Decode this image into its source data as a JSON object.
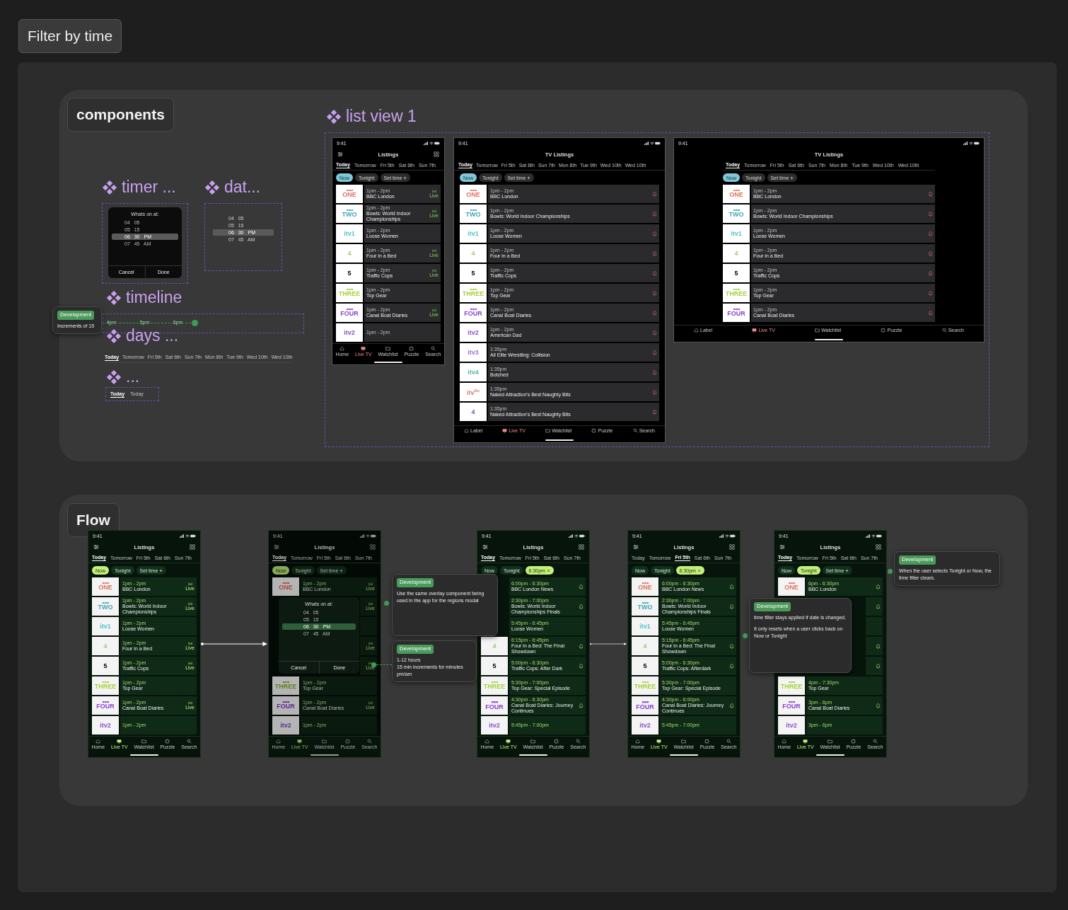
{
  "title": "Filter by time",
  "components": {
    "heading": "components",
    "timer": {
      "label": "timer ...",
      "modal": {
        "title": "Whats on at:",
        "wheel": [
          {
            "values": [
              "04",
              "05"
            ],
            "selected": false
          },
          {
            "values": [
              "05",
              "15"
            ],
            "selected": false
          },
          {
            "values": [
              "06",
              "30",
              "PM"
            ],
            "selected": true
          },
          {
            "values": [
              "07",
              "45",
              "AM"
            ],
            "selected": false
          }
        ],
        "buttons": [
          "Cancel",
          "Done"
        ]
      }
    },
    "date": {
      "label": "dat...",
      "wheel": [
        {
          "values": [
            "04",
            "05"
          ],
          "selected": false
        },
        {
          "values": [
            "05",
            "15"
          ],
          "selected": false
        },
        {
          "values": [
            "06",
            "30",
            "PM"
          ],
          "selected": true
        },
        {
          "values": [
            "07",
            "45",
            "AM"
          ],
          "selected": false
        }
      ]
    },
    "timeline": {
      "label": "timeline",
      "note": {
        "tag": "Development",
        "paragraphs": [
          "Increments of 15"
        ]
      },
      "ticks": [
        "4pm",
        "5pm",
        "6pm"
      ],
      "level": 0.47
    },
    "days": {
      "label": "days ...",
      "tabs": [
        {
          "label": "Today",
          "selected": true
        },
        {
          "label": "Tomorrow",
          "selected": false
        },
        {
          "label": "Fri 5th",
          "selected": false
        },
        {
          "label": "Sat 6th",
          "selected": false
        },
        {
          "label": "Sun 7th",
          "selected": false
        },
        {
          "label": "Mon 8th",
          "selected": false
        },
        {
          "label": "Tue 9th",
          "selected": false
        },
        {
          "label": "Wed 10th",
          "selected": false
        },
        {
          "label": "Wed 10th",
          "selected": false
        }
      ]
    },
    "more": {
      "label": "...",
      "tabs": [
        {
          "label": "Today",
          "selected": true
        },
        {
          "label": "Today",
          "selected": false
        }
      ]
    },
    "list_view": {
      "label": "list view 1",
      "screens": [
        {
          "kind": "phone",
          "dark": true,
          "time": "9:41",
          "title": "Listings",
          "days": [
            {
              "label": "Today",
              "selected": true
            },
            {
              "label": "Tomorrow",
              "selected": false
            },
            {
              "label": "Fri 5th",
              "selected": false
            },
            {
              "label": "Sat 6th",
              "selected": false
            },
            {
              "label": "Sun 7th",
              "selected": false
            }
          ],
          "filters": [
            {
              "label": "Now",
              "selected": true,
              "kind": "plain"
            },
            {
              "label": "Tonight",
              "selected": false,
              "kind": "plain"
            },
            {
              "label": "Set time",
              "selected": false,
              "kind": "add"
            }
          ],
          "rows": [
            {
              "logo": {
                "text": "ONE",
                "kind": "bbc",
                "color": "#e0705f"
              },
              "time": "1pm - 2pm",
              "title": "BBC London",
              "kind": "live",
              "status_text": "Live"
            },
            {
              "logo": {
                "text": "TWO",
                "kind": "bbc",
                "color": "#3fa6b5"
              },
              "time": "1pm - 2pm",
              "title": "Bowls: World Indoor Championships",
              "kind": "live",
              "status_text": "Live"
            },
            {
              "logo": {
                "text": "itv1",
                "kind": "plain",
                "color": "#4fc3cf"
              },
              "time": "1pm - 2pm",
              "title": "Loose Women",
              "kind": "plain"
            },
            {
              "logo": {
                "text": "4",
                "kind": "plain",
                "color": "#9fcf6a"
              },
              "time": "1pm - 2pm",
              "title": "Four in a Bed",
              "kind": "live",
              "status_text": "Live"
            },
            {
              "logo": {
                "text": "5",
                "kind": "plain",
                "color": "#000000"
              },
              "time": "1pm - 2pm",
              "title": "Traffic Cops",
              "kind": "live",
              "status_text": "Live"
            },
            {
              "logo": {
                "text": "THREE",
                "kind": "bbc",
                "color": "#a3d13a"
              },
              "time": "1pm - 2pm",
              "title": "Top Gear",
              "kind": "plain"
            },
            {
              "logo": {
                "text": "FOUR",
                "kind": "bbc",
                "color": "#8b3fd0"
              },
              "time": "1pm - 2pm",
              "title": "Canal Boat Diaries",
              "kind": "live",
              "status_text": "Live"
            },
            {
              "logo": {
                "text": "itv2",
                "kind": "plain",
                "color": "#8a4fd0"
              },
              "time": "1pm - 2pm",
              "kind": "plain"
            }
          ],
          "nav": [
            {
              "label": "Home",
              "selected": false
            },
            {
              "label": "Live TV",
              "selected": true
            },
            {
              "label": "Watchlist",
              "selected": false
            },
            {
              "label": "Puzzle",
              "selected": false
            },
            {
              "label": "Search",
              "selected": false
            }
          ]
        },
        {
          "kind": "tablet",
          "dark": true,
          "time": "9:41",
          "title": "TV Listings",
          "days": [
            {
              "label": "Today",
              "selected": true
            },
            {
              "label": "Tomorrow",
              "selected": false
            },
            {
              "label": "Fri 5th",
              "selected": false
            },
            {
              "label": "Sat 6th",
              "selected": false
            },
            {
              "label": "Sun 7th",
              "selected": false
            },
            {
              "label": "Mon 8th",
              "selected": false
            },
            {
              "label": "Tue 9th",
              "selected": false
            },
            {
              "label": "Wed 10th",
              "selected": false
            },
            {
              "label": "Wed 10th",
              "selected": false
            }
          ],
          "filters": [
            {
              "label": "Now",
              "selected": true,
              "kind": "plain"
            },
            {
              "label": "Tonight",
              "selected": false,
              "kind": "plain"
            },
            {
              "label": "Set time",
              "selected": false,
              "kind": "add"
            }
          ],
          "rows": [
            {
              "logo": {
                "text": "ONE",
                "kind": "bbc",
                "color": "#e0705f"
              },
              "time": "1pm - 2pm",
              "title": "BBC London",
              "kind": "reminder"
            },
            {
              "logo": {
                "text": "TWO",
                "kind": "bbc",
                "color": "#3fa6b5"
              },
              "time": "1pm - 2pm",
              "title": "Bowls: World Indoor Championships",
              "kind": "reminder"
            },
            {
              "logo": {
                "text": "itv1",
                "kind": "plain",
                "color": "#4fc3cf"
              },
              "time": "1pm - 2pm",
              "title": "Loose Women",
              "kind": "reminder"
            },
            {
              "logo": {
                "text": "4",
                "kind": "plain",
                "color": "#9fcf6a"
              },
              "time": "1pm - 2pm",
              "title": "Four in a Bed",
              "kind": "reminder"
            },
            {
              "logo": {
                "text": "5",
                "kind": "plain",
                "color": "#000000"
              },
              "time": "1pm - 2pm",
              "title": "Traffic Cops",
              "kind": "reminder"
            },
            {
              "logo": {
                "text": "THREE",
                "kind": "bbc",
                "color": "#a3d13a"
              },
              "time": "1pm - 2pm",
              "title": "Top Gear",
              "kind": "reminder"
            },
            {
              "logo": {
                "text": "FOUR",
                "kind": "bbc",
                "color": "#8b3fd0"
              },
              "time": "1pm - 2pm",
              "title": "Canal Boat Diaries",
              "kind": "reminder"
            },
            {
              "logo": {
                "text": "itv2",
                "kind": "plain",
                "color": "#8a4fd0"
              },
              "time": "1pm - 2pm",
              "title": "American Dad",
              "kind": "reminder"
            },
            {
              "logo": {
                "text": "itv3",
                "kind": "plain",
                "color": "#9a6fd8"
              },
              "time": "1:35pm",
              "title": "All Elite Wrestling: Collision",
              "kind": "reminder"
            },
            {
              "logo": {
                "text": "itv4",
                "kind": "plain",
                "color": "#4fbf9a"
              },
              "time": "1:35pm",
              "title": "Botched",
              "kind": "reminder"
            },
            {
              "logo": {
                "text": "itv$^{Be}$",
                "kind": "plain",
                "color": "#e07a70"
              },
              "time": "1:35pm",
              "title": "Naked Attraction's Best Naughty Bits",
              "kind": "reminder"
            },
            {
              "logo": {
                "text": "4",
                "kind": "plain",
                "color": "#7a4fc8"
              },
              "time": "1:35pm",
              "title": "Naked Attraction's Best Naughty Bits",
              "kind": "reminder"
            }
          ],
          "nav": [
            {
              "label": "Label",
              "selected": false
            },
            {
              "label": "Live TV",
              "selected": true
            },
            {
              "label": "Watchlist",
              "selected": false
            },
            {
              "label": "Puzzle",
              "selected": false
            },
            {
              "label": "Search",
              "selected": false
            }
          ]
        },
        {
          "kind": "landscape",
          "dark": true,
          "time": "9:41",
          "title": "TV Listings",
          "days": [
            {
              "label": "Today",
              "selected": true
            },
            {
              "label": "Tomorrow",
              "selected": false
            },
            {
              "label": "Fri 5th",
              "selected": false
            },
            {
              "label": "Sat 6th",
              "selected": false
            },
            {
              "label": "Sun 7th",
              "selected": false
            },
            {
              "label": "Mon 8th",
              "selected": false
            },
            {
              "label": "Tue 9th",
              "selected": false
            },
            {
              "label": "Wed 10th",
              "selected": false
            },
            {
              "label": "Wed 10th",
              "selected": false
            }
          ],
          "filters": [
            {
              "label": "Now",
              "selected": true,
              "kind": "plain"
            },
            {
              "label": "Tonight",
              "selected": false,
              "kind": "plain"
            },
            {
              "label": "Set time",
              "selected": false,
              "kind": "add"
            }
          ],
          "rows": [
            {
              "logo": {
                "text": "ONE",
                "kind": "bbc",
                "color": "#e0705f"
              },
              "time": "1pm - 2pm",
              "title": "BBC London",
              "kind": "reminder"
            },
            {
              "logo": {
                "text": "TWO",
                "kind": "bbc",
                "color": "#3fa6b5"
              },
              "time": "1pm - 2pm",
              "title": "Bowls: World Indoor Championships",
              "kind": "reminder"
            },
            {
              "logo": {
                "text": "itv1",
                "kind": "plain",
                "color": "#4fc3cf"
              },
              "time": "1pm - 2pm",
              "title": "Loose Women",
              "kind": "reminder"
            },
            {
              "logo": {
                "text": "4",
                "kind": "plain",
                "color": "#9fcf6a"
              },
              "time": "1pm - 2pm",
              "title": "Four in a Bed",
              "kind": "reminder"
            },
            {
              "logo": {
                "text": "5",
                "kind": "plain",
                "color": "#000000"
              },
              "time": "1pm - 2pm",
              "title": "Traffic Cops",
              "kind": "reminder"
            },
            {
              "logo": {
                "text": "THREE",
                "kind": "bbc",
                "color": "#a3d13a"
              },
              "time": "1pm - 2pm",
              "title": "Top Gear",
              "kind": "reminder"
            },
            {
              "logo": {
                "text": "FOUR",
                "kind": "bbc",
                "color": "#8b3fd0"
              },
              "time": "1pm - 2pm",
              "title": "Canal Boat Diaries",
              "kind": "reminder"
            }
          ],
          "nav": [
            {
              "label": "Label",
              "selected": false
            },
            {
              "label": "Live TV",
              "selected": true
            },
            {
              "label": "Watchlist",
              "selected": false
            },
            {
              "label": "Puzzle",
              "selected": false
            },
            {
              "label": "Search",
              "selected": false
            }
          ]
        }
      ]
    }
  },
  "flow": {
    "heading": "Flow",
    "screens": [
      {
        "kind": "phone",
        "dark": false,
        "time": "9:41",
        "title": "Listings",
        "days": [
          {
            "label": "Today",
            "selected": true
          },
          {
            "label": "Tomorrow",
            "selected": false
          },
          {
            "label": "Fri 5th",
            "selected": false
          },
          {
            "label": "Sat 6th",
            "selected": false
          },
          {
            "label": "Sun 7th",
            "selected": false
          }
        ],
        "filters": [
          {
            "label": "Now",
            "selected": true,
            "kind": "plain"
          },
          {
            "label": "Tonight",
            "selected": false,
            "kind": "plain"
          },
          {
            "label": "Set time",
            "selected": false,
            "kind": "add"
          }
        ],
        "rows": [
          {
            "logo": {
              "text": "ONE",
              "kind": "bbc",
              "color": "#e0705f"
            },
            "time": "1pm - 2pm",
            "title": "BBC London",
            "kind": "live",
            "status_text": "Live"
          },
          {
            "logo": {
              "text": "TWO",
              "kind": "bbc",
              "color": "#3fa6b5"
            },
            "time": "1pm - 2pm",
            "title": "Bowls: World Indoor Championships",
            "kind": "live",
            "status_text": "Live"
          },
          {
            "logo": {
              "text": "itv1",
              "kind": "plain",
              "color": "#4fc3cf"
            },
            "time": "1pm - 2pm",
            "title": "Loose Women",
            "kind": "plain"
          },
          {
            "logo": {
              "text": "4",
              "kind": "plain",
              "color": "#9fcf6a"
            },
            "time": "1pm - 2pm",
            "title": "Four in a Bed",
            "kind": "live",
            "status_text": "Live"
          },
          {
            "logo": {
              "text": "5",
              "kind": "plain",
              "color": "#000000"
            },
            "time": "1pm - 2pm",
            "title": "Traffic Cops",
            "kind": "live",
            "status_text": "Live"
          },
          {
            "logo": {
              "text": "THREE",
              "kind": "bbc",
              "color": "#a3d13a"
            },
            "time": "1pm - 2pm",
            "title": "Top Gear",
            "kind": "plain"
          },
          {
            "logo": {
              "text": "FOUR",
              "kind": "bbc",
              "color": "#8b3fd0"
            },
            "time": "1pm - 2pm",
            "title": "Canal Boat Diaries",
            "kind": "live",
            "status_text": "Live"
          },
          {
            "logo": {
              "text": "itv2",
              "kind": "plain",
              "color": "#8a4fd0"
            },
            "time": "1pm - 2pm",
            "kind": "plain"
          }
        ],
        "nav": [
          {
            "label": "Home",
            "selected": false
          },
          {
            "label": "Live TV",
            "selected": true
          },
          {
            "label": "Watchlist",
            "selected": false
          },
          {
            "label": "Puzzle",
            "selected": false
          },
          {
            "label": "Search",
            "selected": false
          }
        ]
      },
      {
        "kind": "phone",
        "dark": false,
        "dimmed": true,
        "time": "9:41",
        "title": "Listings",
        "days": [
          {
            "label": "Today",
            "selected": true
          },
          {
            "label": "Tomorrow",
            "selected": false
          },
          {
            "label": "Fri 5th",
            "selected": false
          },
          {
            "label": "Sat 6th",
            "selected": false
          },
          {
            "label": "Sun 7th",
            "selected": false
          }
        ],
        "filters": [
          {
            "label": "Now",
            "selected": true,
            "kind": "plain"
          },
          {
            "label": "Tonight",
            "selected": false,
            "kind": "plain"
          },
          {
            "label": "Set time",
            "selected": false,
            "kind": "add"
          }
        ],
        "rows": [
          {
            "logo": {
              "text": "ONE",
              "kind": "bbc",
              "color": "#a8483c"
            },
            "time": "1pm - 2pm",
            "title": "BBC London",
            "kind": "live",
            "status_text": "Live"
          },
          {
            "kind": "live",
            "status_text": "Live"
          },
          {
            "kind": "plain"
          },
          {
            "kind": "live",
            "status_text": "Live"
          },
          {
            "kind": "live",
            "status_text": "Live"
          },
          {
            "logo": {
              "text": "THREE",
              "kind": "bbc",
              "color": "#5f7d1c"
            },
            "time": "1pm - 2pm",
            "title": "Top Gear",
            "kind": "plain"
          },
          {
            "logo": {
              "text": "FOUR",
              "kind": "bbc",
              "color": "#5a2690"
            },
            "time": "1pm - 2pm",
            "title": "Canal Boat Diaries",
            "kind": "live",
            "status_text": "Live"
          },
          {
            "logo": {
              "text": "itv2",
              "kind": "plain",
              "color": "#5a3090"
            },
            "time": "1pm - 2pm",
            "kind": "plain"
          }
        ],
        "nav": [
          {
            "label": "Home",
            "selected": false
          },
          {
            "label": "Live TV",
            "selected": true
          },
          {
            "label": "Watchlist",
            "selected": false
          },
          {
            "label": "Puzzle",
            "selected": false
          },
          {
            "label": "Search",
            "selected": false
          }
        ],
        "modal": {
          "title": "Whats on at:",
          "wheel": [
            {
              "values": [
                "04",
                "05"
              ],
              "selected": false
            },
            {
              "values": [
                "05",
                "15"
              ],
              "selected": false
            },
            {
              "values": [
                "06",
                "30",
                "PM"
              ],
              "selected": true
            },
            {
              "values": [
                "07",
                "45",
                "AM"
              ],
              "selected": false
            }
          ],
          "buttons": [
            "Cancel",
            "Done"
          ]
        }
      },
      {
        "kind": "phone",
        "dark": false,
        "time": "9:41",
        "title": "Listings",
        "days": [
          {
            "label": "Today",
            "selected": true
          },
          {
            "label": "Tomorrow",
            "selected": false
          },
          {
            "label": "Fri 5th",
            "selected": false
          },
          {
            "label": "Sat 6th",
            "selected": false
          },
          {
            "label": "Sun 7th",
            "selected": false
          }
        ],
        "filters": [
          {
            "label": "Now",
            "selected": false,
            "kind": "plain"
          },
          {
            "label": "Tonight",
            "selected": false,
            "kind": "plain"
          },
          {
            "label": "6:30pm",
            "selected": true,
            "kind": "clear"
          }
        ],
        "rows": [
          {
            "time": "6:00pm - 6:30pm",
            "title": "BBC London News",
            "kind": "reminder"
          },
          {
            "time": "2:30pm - 7:00pm",
            "title": "Bowls: World Indoor Championships Finals",
            "kind": "reminder"
          },
          {
            "time": "5:45pm - 6:45pm",
            "title": "Loose Women",
            "kind": "plain"
          },
          {
            "logo": {
              "text": "4",
              "kind": "plain",
              "color": "#9fcf6a"
            },
            "time": "6:15pm - 6:45pm",
            "title": "Four in a Bed: The Final Showdown",
            "kind": "reminder"
          },
          {
            "logo": {
              "text": "5",
              "kind": "plain",
              "color": "#000000"
            },
            "time": "5:00pm - 6:30pm",
            "title": "Traffic Cops: After Dark",
            "kind": "reminder"
          },
          {
            "logo": {
              "text": "THREE",
              "kind": "bbc",
              "color": "#a3d13a"
            },
            "time": "5:30pm - 7:00pm",
            "title": "Top Gear: Special Episode",
            "kind": "plain"
          },
          {
            "logo": {
              "text": "FOUR",
              "kind": "bbc",
              "color": "#8b3fd0"
            },
            "time": "4:30pm - 6:30pm",
            "title": "Canal Boat Diaries: Journey Continues",
            "kind": "reminder"
          },
          {
            "logo": {
              "text": "itv2",
              "kind": "plain",
              "color": "#8a4fd0"
            },
            "time": "5:45pm - 7:00pm",
            "kind": "plain"
          }
        ],
        "nav": [
          {
            "label": "Home",
            "selected": false
          },
          {
            "label": "Live TV",
            "selected": true
          },
          {
            "label": "Watchlist",
            "selected": false
          },
          {
            "label": "Puzzle",
            "selected": false
          },
          {
            "label": "Search",
            "selected": false
          }
        ]
      },
      {
        "kind": "phone",
        "dark": false,
        "time": "9:41",
        "title": "Listings",
        "days": [
          {
            "label": "Today",
            "selected": false
          },
          {
            "label": "Tomorrow",
            "selected": false
          },
          {
            "label": "Fri 5th",
            "selected": true
          },
          {
            "label": "Sat 6th",
            "selected": false
          },
          {
            "label": "Sun 7th",
            "selected": false
          }
        ],
        "filters": [
          {
            "label": "Now",
            "selected": false,
            "kind": "plain"
          },
          {
            "label": "Tonight",
            "selected": false,
            "kind": "plain"
          },
          {
            "label": "6:30pm",
            "selected": true,
            "kind": "clear"
          }
        ],
        "rows": [
          {
            "logo": {
              "text": "ONE",
              "kind": "bbc",
              "color": "#e0705f"
            },
            "time": "6:00pm - 6:30pm",
            "title": "BBC London News",
            "kind": "reminder"
          },
          {
            "logo": {
              "text": "TWO",
              "kind": "bbc",
              "color": "#3fa6b5"
            },
            "time": "2:30pm - 7:00pm",
            "title": "Bowls: World Indoor Championships Finals",
            "kind": "reminder"
          },
          {
            "logo": {
              "text": "itv1",
              "kind": "plain",
              "color": "#4fc3cf"
            },
            "time": "5:45pm - 6:45pm",
            "title": "Loose Women",
            "kind": "plain"
          },
          {
            "logo": {
              "text": "4",
              "kind": "plain",
              "color": "#9fcf6a"
            },
            "time": "5:15pm - 6:45pm",
            "title": "Four in a Bed: The Final Showdown",
            "kind": "reminder"
          },
          {
            "logo": {
              "text": "5",
              "kind": "plain",
              "color": "#000000"
            },
            "time": "5:00pm - 6:30pm",
            "title": "Traffic Cops: Afterdark",
            "kind": "reminder"
          },
          {
            "logo": {
              "text": "THREE",
              "kind": "bbc",
              "color": "#a3d13a"
            },
            "time": "5:30pm - 7:00pm",
            "title": "Top Gear: Special Episode",
            "kind": "plain"
          },
          {
            "logo": {
              "text": "FOUR",
              "kind": "bbc",
              "color": "#8b3fd0"
            },
            "time": "4:30pm - 6:00pm",
            "title": "Canal Boat Diaries: Journey Continues",
            "kind": "reminder"
          },
          {
            "logo": {
              "text": "itv2",
              "kind": "plain",
              "color": "#8a4fd0"
            },
            "time": "5:45pm - 7:00pm",
            "kind": "plain"
          }
        ],
        "nav": [
          {
            "label": "Home",
            "selected": false
          },
          {
            "label": "Live TV",
            "selected": true
          },
          {
            "label": "Watchlist",
            "selected": false
          },
          {
            "label": "Puzzle",
            "selected": false
          },
          {
            "label": "Search",
            "selected": false
          }
        ]
      },
      {
        "kind": "phone",
        "dark": false,
        "time": "9:41",
        "title": "Listings",
        "days": [
          {
            "label": "Today",
            "selected": true
          },
          {
            "label": "Tomorrow",
            "selected": false
          },
          {
            "label": "Fri 5th",
            "selected": false
          },
          {
            "label": "Sat 6th",
            "selected": false
          },
          {
            "label": "Sun 7th",
            "selected": false
          }
        ],
        "filters": [
          {
            "label": "Now",
            "selected": false,
            "kind": "plain"
          },
          {
            "label": "Tonight",
            "selected": true,
            "kind": "plain"
          },
          {
            "label": "Set time",
            "selected": false,
            "kind": "add"
          }
        ],
        "rows": [
          {
            "logo": {
              "text": "ONE",
              "kind": "bbc",
              "color": "#e0705f"
            },
            "time": "6pm - 6:30pm",
            "title": "BBC London",
            "kind": "reminder"
          },
          {
            "kind": "reminder"
          },
          {
            "kind": "plain"
          },
          {
            "kind": "reminder"
          },
          {
            "kind": "reminder"
          },
          {
            "logo": {
              "text": "THREE",
              "kind": "bbc",
              "color": "#a3d13a"
            },
            "time": "4pm - 7:30pm",
            "title": "Top Gear",
            "kind": "plain"
          },
          {
            "logo": {
              "text": "FOUR",
              "kind": "bbc",
              "color": "#8b3fd0"
            },
            "time": "3pm - 6pm",
            "title": "Canal Boat Diaries",
            "kind": "reminder"
          },
          {
            "logo": {
              "text": "itv2",
              "kind": "plain",
              "color": "#8a4fd0"
            },
            "time": "3pm - 6pm",
            "kind": "plain"
          }
        ],
        "nav": [
          {
            "label": "Home",
            "selected": false
          },
          {
            "label": "Live TV",
            "selected": true
          },
          {
            "label": "Watchlist",
            "selected": false
          },
          {
            "label": "Puzzle",
            "selected": false
          },
          {
            "label": "Search",
            "selected": false
          }
        ]
      }
    ],
    "notes": [
      {
        "tag": "Development",
        "paragraphs": [
          "Use the same overlay component being used in the app for the regions modal"
        ]
      },
      {
        "tag": "Development",
        "paragraphs": [
          "1-12 hours",
          "15 min increments for minutes",
          "pm/am"
        ]
      },
      {
        "tag": "Development",
        "paragraphs": [
          "time filter stays applied if date is changed.",
          "It only resets when a user clicks back on Now or Tonight"
        ]
      },
      {
        "tag": "Development",
        "paragraphs": [
          "When the user selects Tonight or Now, the time filter clears."
        ]
      }
    ]
  }
}
